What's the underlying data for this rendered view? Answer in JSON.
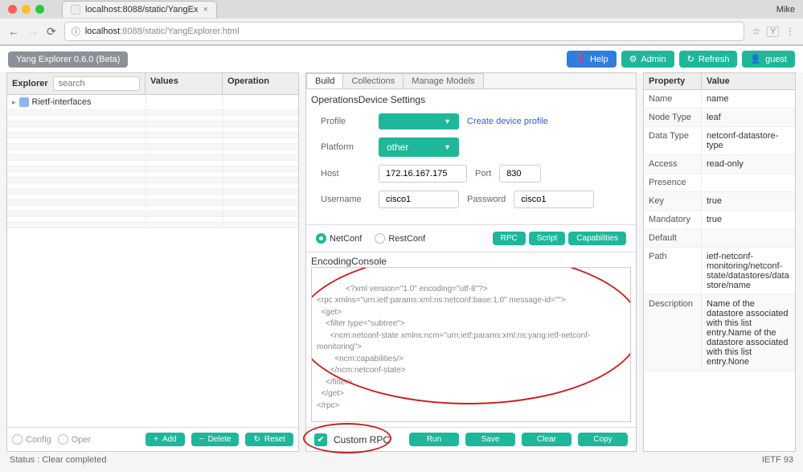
{
  "browser": {
    "tab_title": "localhost:8088/static/YangEx",
    "url_host": "localhost",
    "url_port": ":8088",
    "url_path": "/static/YangExplorer.html",
    "user": "Mike",
    "info_glyph": "ⓘ",
    "star_glyph": "☆",
    "y_glyph": "Y",
    "menu_glyph": "⋮",
    "back": "←",
    "fwd": "→",
    "reload": "⟳"
  },
  "app": {
    "title": "Yang Explorer 0.6.0 (Beta)",
    "help": "Help",
    "admin": "Admin",
    "refresh": "Refresh",
    "guest": "guest",
    "help_icon": "❓",
    "admin_icon": "⚙",
    "refresh_icon": "↻",
    "guest_icon": "👤"
  },
  "left": {
    "explorer": "Explorer",
    "values": "Values",
    "operation": "Operation",
    "search_ph": "search",
    "tree_root": "Rietf-interfaces",
    "config": "Config",
    "oper": "Oper",
    "add": "Add",
    "delete": "Delete",
    "reset": "Reset",
    "add_icon": "+",
    "delete_icon": "−",
    "reset_icon": "↻"
  },
  "center": {
    "tabs": {
      "build": "Build",
      "collections": "Collections",
      "manage": "Manage Models"
    },
    "subtabs": {
      "operations": "Operations",
      "device": "Device Settings"
    },
    "profile_label": "Profile",
    "platform_label": "Platform",
    "platform_value": "other",
    "create_profile": "Create device profile",
    "host_label": "Host",
    "host_value": "172.16.167.175",
    "port_label": "Port",
    "port_value": "830",
    "username_label": "Username",
    "username_value": "cisco1",
    "password_label": "Password",
    "password_value": "cisco1",
    "netconf": "NetConf",
    "restconf": "RestConf",
    "rpc": "RPC",
    "script": "Script",
    "capabilities": "Capabilities",
    "code_tabs": {
      "encoding": "Encoding",
      "console": "Console"
    },
    "code": "<?xml version=\"1.0\" encoding=\"utf-8\"?>\n<rpc xmlns=\"urn:ietf:params:xml:ns:netconf:base:1.0\" message-id=\"\">\n  <get>\n    <filter type=\"subtree\">\n      <ncm:netconf-state xmlns:ncm=\"urn:ietf:params:xml:ns:yang:ietf-netconf-monitoring\">\n        <ncm:capabilities/>\n      </ncm:netconf-state>\n    </filter>\n  </get>\n</rpc>",
    "custom_rpc": "Custom RPC",
    "run": "Run",
    "save": "Save",
    "clear": "Clear",
    "copy": "Copy",
    "check": "✔"
  },
  "right": {
    "property": "Property",
    "value": "Value",
    "rows": [
      {
        "p": "Name",
        "v": "name"
      },
      {
        "p": "Node Type",
        "v": "leaf"
      },
      {
        "p": "Data Type",
        "v": "netconf-datastore-type"
      },
      {
        "p": "Access",
        "v": "read-only"
      },
      {
        "p": "Presence",
        "v": ""
      },
      {
        "p": "Key",
        "v": "true"
      },
      {
        "p": "Mandatory",
        "v": "true"
      },
      {
        "p": "Default",
        "v": ""
      },
      {
        "p": "Path",
        "v": "ietf-netconf-monitoring/netconf-state/datastores/datastore/name"
      },
      {
        "p": "Description",
        "v": "Name of the datastore associated with this list entry.Name of the datastore associated with this list entry.None"
      }
    ]
  },
  "status": {
    "left": "Status : Clear completed",
    "right": "IETF 93"
  }
}
